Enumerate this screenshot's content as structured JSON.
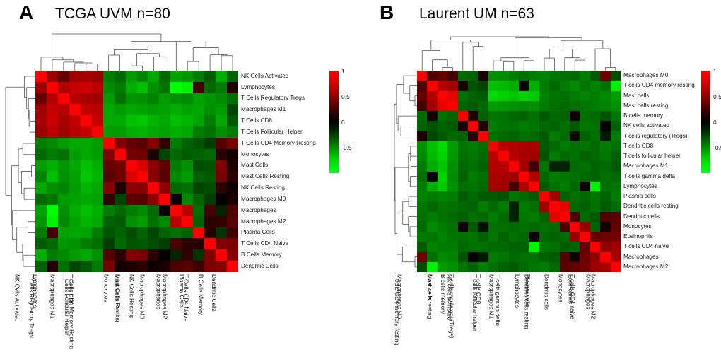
{
  "figure": {
    "panels": [
      {
        "letter": "A",
        "title": "TCGA UVM n=80",
        "n": 80,
        "cohort": "TCGA UVM"
      },
      {
        "letter": "B",
        "title": "Laurent UM n=63",
        "n": 63,
        "cohort": "Laurent UM"
      }
    ]
  },
  "colorbar": {
    "ticks": [
      "1",
      "0.5",
      "0",
      "-0.5"
    ],
    "tick_values": [
      1,
      0.5,
      0,
      -0.5
    ],
    "max_color": "#ff0000",
    "mid_color": "#000000",
    "min_color": "#00ff22",
    "vmin": -0.75,
    "vmax": 1
  },
  "chart_data": [
    {
      "type": "heatmap",
      "panel": "A",
      "title": "TCGA UVM n=80",
      "xlabel": "",
      "ylabel": "",
      "legend_position": "right",
      "grid": false,
      "zlim": [
        -0.75,
        1
      ],
      "categories": [
        "NK Cells Activated",
        "Lymphocytes",
        "T Cells Regulatory Tregs",
        "Macrophages M1",
        "T Cells CD8",
        "T Cells Follicular Helper",
        "T Cells CD4 Memory Resting",
        "Monocytes",
        "Mast Cells",
        "Mast Cells Resting",
        "NK Cells Resting",
        "Macrophages M0",
        "Macrophages",
        "Macrophages M2",
        "Plasma Cells",
        "T Cells CD4 Naive",
        "B Cells Memory",
        "Dendritic Cells"
      ],
      "row_labels": [
        "NK Cells Activated",
        "Lymphocytes",
        "T Cells Regulatory Tregs",
        "Macrophages M1",
        "T Cells CD8",
        "T Cells Follicular Helper",
        "T Cells CD4 Memory Resting",
        "Monocytes",
        "Mast Cells",
        "Mast Cells Resting",
        "NK Cells Resting",
        "Macrophages M0",
        "Macrophages",
        "Macrophages M2",
        "Plasma Cells",
        "T Cells CD4 Naive",
        "B Cells Memory",
        "Dendritic Cells"
      ],
      "col_labels": [
        "NK Cells Activated",
        "Lymphocytes",
        "T Cells Regulatory Tregs",
        "Macrophages M1",
        "T Cells CD8",
        "T Cells Follicular Helper",
        "T Cells CD4 Memory Resting",
        "Monocytes",
        "Mast Cells",
        "Mast Cells Resting",
        "NK Cells Resting",
        "Macrophages M0",
        "Macrophages",
        "Macrophages M2",
        "Plasma Cells",
        "T Cells CD4 Naive",
        "B Cells Memory",
        "Dendritic Cells"
      ],
      "values": [
        [
          1.0,
          0.52,
          0.3,
          0.55,
          0.58,
          0.52,
          -0.3,
          -0.24,
          -0.4,
          -0.32,
          -0.44,
          -0.24,
          -0.42,
          -0.38,
          -0.3,
          -0.2,
          -0.46,
          -0.22
        ],
        [
          0.52,
          1.0,
          0.62,
          0.72,
          0.75,
          0.66,
          -0.34,
          -0.3,
          -0.46,
          -0.52,
          -0.36,
          -0.28,
          -0.76,
          -0.7,
          0.18,
          -0.24,
          -0.3,
          0.08
        ],
        [
          0.3,
          0.62,
          1.0,
          0.64,
          0.58,
          0.55,
          -0.4,
          -0.26,
          -0.38,
          -0.36,
          -0.32,
          -0.4,
          -0.36,
          -0.34,
          -0.42,
          -0.38,
          -0.34,
          -0.26
        ],
        [
          0.55,
          0.72,
          0.64,
          1.0,
          0.7,
          0.66,
          -0.44,
          -0.4,
          -0.44,
          -0.42,
          -0.4,
          -0.42,
          -0.46,
          -0.42,
          -0.44,
          -0.36,
          -0.4,
          -0.14
        ],
        [
          0.58,
          0.75,
          0.58,
          0.7,
          1.0,
          0.72,
          -0.44,
          -0.44,
          -0.52,
          -0.55,
          -0.48,
          -0.44,
          -0.52,
          -0.48,
          -0.42,
          -0.3,
          -0.44,
          -0.2
        ],
        [
          0.52,
          0.66,
          0.55,
          0.66,
          0.72,
          1.0,
          -0.4,
          -0.4,
          -0.46,
          -0.48,
          -0.44,
          -0.42,
          -0.46,
          -0.44,
          -0.3,
          -0.26,
          -0.36,
          -0.3
        ],
        [
          -0.3,
          -0.34,
          -0.4,
          -0.44,
          -0.44,
          -0.4,
          1.0,
          0.42,
          0.3,
          0.26,
          0.44,
          0.12,
          -0.3,
          -0.22,
          -0.18,
          -0.12,
          0.24,
          0.38
        ],
        [
          -0.24,
          -0.3,
          -0.26,
          -0.4,
          -0.44,
          -0.4,
          0.42,
          1.0,
          0.36,
          0.34,
          0.06,
          -0.14,
          -0.24,
          -0.2,
          -0.22,
          -0.24,
          0.1,
          0.04
        ],
        [
          -0.4,
          -0.46,
          -0.38,
          -0.44,
          -0.52,
          -0.46,
          0.3,
          0.36,
          1.0,
          0.82,
          0.46,
          0.28,
          -0.3,
          -0.36,
          -0.16,
          -0.18,
          0.42,
          0.06
        ],
        [
          -0.32,
          -0.52,
          -0.36,
          -0.42,
          -0.55,
          -0.48,
          0.26,
          0.34,
          0.82,
          1.0,
          0.44,
          0.26,
          -0.34,
          -0.4,
          -0.22,
          -0.2,
          0.38,
          0.1
        ],
        [
          -0.44,
          -0.36,
          -0.32,
          -0.4,
          -0.48,
          -0.44,
          0.44,
          0.06,
          0.46,
          0.44,
          1.0,
          0.48,
          -0.24,
          -0.26,
          -0.14,
          -0.16,
          0.1,
          0.02
        ],
        [
          -0.24,
          -0.28,
          -0.4,
          -0.42,
          -0.44,
          -0.42,
          0.12,
          -0.14,
          0.28,
          0.26,
          0.48,
          1.0,
          0.02,
          -0.34,
          -0.22,
          -0.12,
          0.0,
          0.06
        ],
        [
          -0.42,
          -0.76,
          -0.36,
          -0.46,
          -0.52,
          -0.46,
          -0.3,
          -0.24,
          -0.3,
          -0.34,
          -0.24,
          0.02,
          1.0,
          0.66,
          -0.26,
          0.2,
          -0.06,
          0.22
        ],
        [
          -0.38,
          -0.7,
          -0.34,
          -0.42,
          -0.48,
          -0.44,
          -0.22,
          -0.2,
          -0.36,
          -0.4,
          -0.26,
          -0.34,
          0.66,
          1.0,
          -0.22,
          0.1,
          0.12,
          0.26
        ],
        [
          -0.3,
          0.18,
          -0.42,
          -0.44,
          -0.42,
          -0.3,
          -0.18,
          -0.22,
          -0.16,
          -0.22,
          -0.14,
          -0.22,
          -0.26,
          -0.22,
          1.0,
          0.08,
          -0.1,
          0.16
        ],
        [
          -0.2,
          -0.24,
          -0.38,
          -0.36,
          -0.3,
          -0.26,
          -0.12,
          -0.24,
          -0.18,
          -0.2,
          -0.16,
          -0.12,
          0.2,
          0.1,
          0.08,
          1.0,
          0.42,
          0.4
        ],
        [
          -0.46,
          -0.3,
          -0.34,
          -0.4,
          -0.44,
          -0.36,
          0.24,
          0.1,
          0.42,
          0.38,
          0.1,
          0.0,
          -0.06,
          0.12,
          -0.1,
          0.42,
          1.0,
          0.44
        ],
        [
          -0.22,
          0.08,
          -0.26,
          -0.14,
          -0.2,
          -0.3,
          0.38,
          0.04,
          0.06,
          0.1,
          0.02,
          0.06,
          0.22,
          0.26,
          0.16,
          0.4,
          0.44,
          1.0
        ]
      ]
    },
    {
      "type": "heatmap",
      "panel": "B",
      "title": "Laurent UM n=63",
      "xlabel": "",
      "ylabel": "",
      "legend_position": "right",
      "grid": false,
      "zlim": [
        -0.75,
        1
      ],
      "categories": [
        "Macrophages M0",
        "T cells CD4 memory resting",
        "Mast  cells",
        "Mast cells resting",
        "B cells memory",
        "NK cells activated",
        "T cells regulatory (Tregs)",
        "T cells CD8",
        "T cells follicular helper",
        "Macrophages M1",
        "T cells gamma delta",
        "Lymphocytes",
        "Plasma cells",
        "Dendritic cells resting",
        "Dendritic cells",
        "Monocytes",
        "Eosinophils",
        "T cells CD4 naive",
        "Macrophages",
        "Macrophages M2"
      ],
      "row_labels": [
        "Macrophages M0",
        "T cells CD4 memory resting",
        "Mast  cells",
        "Mast cells resting",
        "B cells memory",
        "NK cells activated",
        "T cells regulatory (Tregs)",
        "T cells CD8",
        "T cells follicular helper",
        "Macrophages M1",
        "T cells gamma delta",
        "Lymphocytes",
        "Plasma cells",
        "Dendritic cells resting",
        "Dendritic cells",
        "Monocytes",
        "Eosinophils",
        "T cells CD4 naive",
        "Macrophages",
        "Macrophages M2"
      ],
      "col_labels": [
        "Macrophages M0",
        "T cells CD4 memory resting",
        "Mast  cells",
        "Mast cells resting",
        "B cells memory",
        "NK cells activated",
        "T cells regulatory (Tregs)",
        "T cells CD8",
        "T cells follicular helper",
        "Macrophages M1",
        "T cells gamma delta",
        "Lymphocytes",
        "Plasma cells",
        "Dendritic cells resting",
        "Dendritic cells",
        "Monocytes",
        "Eosinophils",
        "T cells CD4 naive",
        "Macrophages",
        "Macrophages M2"
      ],
      "values": [
        [
          1.0,
          0.22,
          0.3,
          0.18,
          -0.24,
          -0.22,
          0.06,
          -0.36,
          -0.34,
          -0.3,
          -0.26,
          -0.3,
          -0.32,
          -0.28,
          -0.26,
          -0.24,
          -0.3,
          -0.2,
          0.34,
          -0.16
        ],
        [
          0.22,
          1.0,
          0.62,
          0.56,
          0.04,
          -0.18,
          -0.14,
          -0.52,
          -0.5,
          -0.46,
          0.0,
          -0.46,
          -0.3,
          -0.24,
          -0.3,
          -0.34,
          -0.28,
          -0.32,
          -0.26,
          -0.7
        ],
        [
          0.3,
          0.62,
          1.0,
          0.88,
          -0.26,
          -0.22,
          -0.2,
          -0.62,
          -0.58,
          -0.54,
          -0.58,
          -0.56,
          -0.32,
          -0.28,
          -0.26,
          -0.3,
          -0.32,
          -0.3,
          -0.34,
          -0.4
        ],
        [
          0.18,
          0.56,
          0.88,
          1.0,
          -0.22,
          -0.2,
          -0.24,
          -0.4,
          -0.38,
          -0.36,
          -0.34,
          -0.36,
          -0.3,
          -0.26,
          -0.24,
          -0.26,
          -0.28,
          -0.3,
          -0.32,
          -0.36
        ],
        [
          -0.24,
          0.04,
          -0.26,
          -0.22,
          1.0,
          0.06,
          -0.22,
          -0.28,
          -0.26,
          -0.24,
          -0.22,
          -0.26,
          -0.2,
          -0.24,
          -0.22,
          0.02,
          -0.26,
          -0.24,
          -0.18,
          -0.28
        ],
        [
          -0.22,
          -0.18,
          -0.22,
          -0.2,
          0.06,
          1.0,
          0.08,
          -0.3,
          -0.28,
          -0.26,
          -0.3,
          -0.28,
          -0.24,
          -0.22,
          -0.26,
          -0.2,
          -0.28,
          -0.26,
          0.0,
          -0.22
        ],
        [
          0.06,
          -0.14,
          -0.2,
          -0.24,
          -0.22,
          0.08,
          1.0,
          -0.26,
          -0.24,
          -0.22,
          -0.26,
          -0.24,
          -0.2,
          -0.3,
          -0.24,
          -0.02,
          -0.22,
          -0.26,
          -0.04,
          -0.3
        ],
        [
          -0.36,
          -0.52,
          -0.62,
          -0.4,
          -0.28,
          -0.3,
          -0.26,
          1.0,
          0.66,
          0.62,
          0.6,
          0.58,
          -0.2,
          -0.24,
          -0.3,
          -0.26,
          -0.28,
          -0.24,
          -0.3,
          -0.26
        ],
        [
          -0.34,
          -0.5,
          -0.58,
          -0.38,
          -0.26,
          -0.28,
          -0.24,
          0.66,
          1.0,
          0.64,
          0.58,
          0.56,
          -0.18,
          -0.3,
          -0.24,
          -0.26,
          -0.22,
          -0.24,
          -0.28,
          -0.22
        ],
        [
          -0.3,
          -0.46,
          -0.54,
          -0.36,
          -0.24,
          -0.26,
          -0.22,
          0.62,
          0.64,
          1.0,
          0.56,
          0.18,
          -0.28,
          -0.06,
          -0.06,
          -0.24,
          -0.26,
          -0.22,
          -0.24,
          -0.2
        ],
        [
          -0.26,
          0.0,
          -0.58,
          -0.34,
          -0.22,
          -0.3,
          -0.26,
          0.6,
          0.58,
          0.56,
          1.0,
          0.62,
          -0.24,
          -0.3,
          -0.28,
          -0.26,
          -0.24,
          -0.22,
          -0.26,
          -0.24
        ],
        [
          -0.3,
          -0.46,
          -0.56,
          -0.36,
          -0.26,
          -0.28,
          -0.24,
          0.58,
          0.56,
          0.18,
          0.62,
          1.0,
          -0.2,
          -0.26,
          -0.3,
          -0.24,
          0.02,
          -0.7,
          -0.26,
          -0.28
        ],
        [
          -0.32,
          -0.3,
          -0.32,
          -0.3,
          -0.2,
          -0.24,
          -0.2,
          -0.2,
          -0.18,
          -0.28,
          -0.24,
          -0.2,
          1.0,
          0.56,
          -0.22,
          -0.26,
          -0.24,
          -0.28,
          -0.22,
          -0.3
        ],
        [
          -0.28,
          -0.24,
          -0.28,
          -0.26,
          -0.24,
          -0.22,
          -0.3,
          -0.24,
          -0.3,
          -0.06,
          -0.3,
          -0.26,
          0.56,
          1.0,
          0.88,
          -0.24,
          -0.22,
          -0.26,
          -0.2,
          -0.24
        ],
        [
          -0.26,
          -0.3,
          -0.26,
          -0.24,
          -0.22,
          -0.26,
          -0.24,
          -0.3,
          -0.24,
          -0.06,
          -0.28,
          -0.3,
          -0.22,
          0.88,
          1.0,
          0.22,
          -0.24,
          -0.2,
          0.24,
          0.26
        ],
        [
          -0.24,
          -0.34,
          -0.3,
          -0.26,
          0.02,
          -0.2,
          -0.02,
          -0.26,
          -0.26,
          -0.24,
          -0.26,
          -0.24,
          -0.26,
          -0.24,
          0.22,
          1.0,
          0.52,
          -0.22,
          0.04,
          0.3
        ],
        [
          -0.3,
          -0.28,
          -0.32,
          -0.28,
          -0.26,
          -0.28,
          -0.22,
          -0.28,
          -0.22,
          -0.26,
          -0.24,
          0.02,
          -0.24,
          -0.22,
          -0.24,
          0.52,
          1.0,
          0.3,
          0.34,
          0.36
        ],
        [
          -0.2,
          -0.32,
          -0.3,
          -0.3,
          -0.24,
          -0.26,
          -0.26,
          -0.24,
          -0.24,
          -0.22,
          -0.22,
          -0.7,
          -0.28,
          -0.26,
          -0.2,
          -0.22,
          0.3,
          1.0,
          0.48,
          0.54
        ],
        [
          0.34,
          -0.26,
          -0.34,
          -0.32,
          -0.18,
          0.0,
          -0.04,
          -0.3,
          -0.28,
          -0.24,
          -0.26,
          -0.26,
          -0.22,
          -0.2,
          0.24,
          0.04,
          0.34,
          0.48,
          1.0,
          0.6
        ],
        [
          -0.16,
          -0.7,
          -0.4,
          -0.36,
          -0.28,
          -0.22,
          -0.3,
          -0.26,
          -0.22,
          -0.2,
          -0.24,
          -0.28,
          -0.3,
          -0.24,
          0.26,
          0.3,
          0.36,
          0.54,
          0.6,
          1.0
        ]
      ]
    }
  ]
}
